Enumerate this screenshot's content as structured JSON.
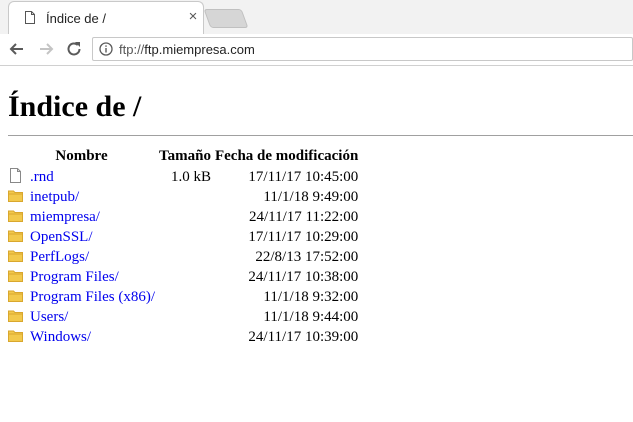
{
  "browser": {
    "tab": {
      "title": "Índice de /",
      "close": "×"
    },
    "address": {
      "scheme": "ftp://",
      "host": "ftp.miempresa.com"
    }
  },
  "page": {
    "heading": "Índice de /",
    "columns": {
      "name": "Nombre",
      "size": "Tamaño",
      "date": "Fecha de modificación"
    },
    "entries": [
      {
        "name": ".rnd",
        "size": "1.0 kB",
        "date": "17/11/17 10:45:00",
        "icon": "file-icon"
      },
      {
        "name": "inetpub/",
        "size": "",
        "date": "11/1/18 9:49:00",
        "icon": "folder-icon"
      },
      {
        "name": "miempresa/",
        "size": "",
        "date": "24/11/17 11:22:00",
        "icon": "folder-icon"
      },
      {
        "name": "OpenSSL/",
        "size": "",
        "date": "17/11/17 10:29:00",
        "icon": "folder-icon"
      },
      {
        "name": "PerfLogs/",
        "size": "",
        "date": "22/8/13 17:52:00",
        "icon": "folder-icon"
      },
      {
        "name": "Program Files/",
        "size": "",
        "date": "24/11/17 10:38:00",
        "icon": "folder-icon"
      },
      {
        "name": "Program Files (x86)/",
        "size": "",
        "date": "11/1/18 9:32:00",
        "icon": "folder-icon"
      },
      {
        "name": "Users/",
        "size": "",
        "date": "11/1/18 9:44:00",
        "icon": "folder-icon"
      },
      {
        "name": "Windows/",
        "size": "",
        "date": "24/11/17 10:39:00",
        "icon": "folder-icon"
      }
    ]
  },
  "colors": {
    "link": "#0000ee",
    "folder": "#f2c94c",
    "folder_dark": "#d9a72e"
  }
}
